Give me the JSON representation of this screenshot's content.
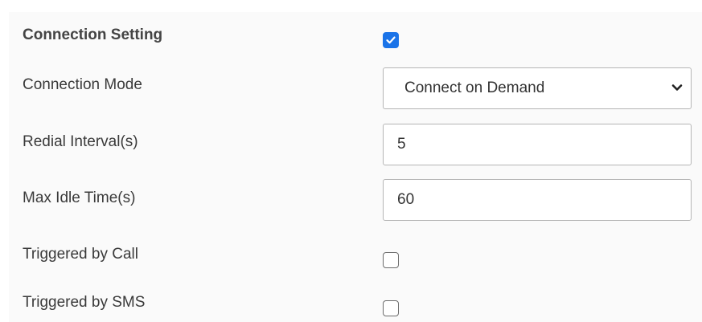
{
  "form": {
    "connection_setting": {
      "label": "Connection Setting",
      "checked": true
    },
    "connection_mode": {
      "label": "Connection Mode",
      "value": "Connect on Demand",
      "icon": "chevron-down-icon"
    },
    "redial_interval": {
      "label": "Redial Interval(s)",
      "value": "5"
    },
    "max_idle_time": {
      "label": "Max Idle Time(s)",
      "value": "60"
    },
    "triggered_by_call": {
      "label": "Triggered by Call",
      "checked": false
    },
    "triggered_by_sms": {
      "label": "Triggered by SMS",
      "checked": false
    }
  },
  "colors": {
    "accent": "#1a73e8",
    "panel_bg": "#fafafa",
    "border": "#b5b5b5"
  }
}
